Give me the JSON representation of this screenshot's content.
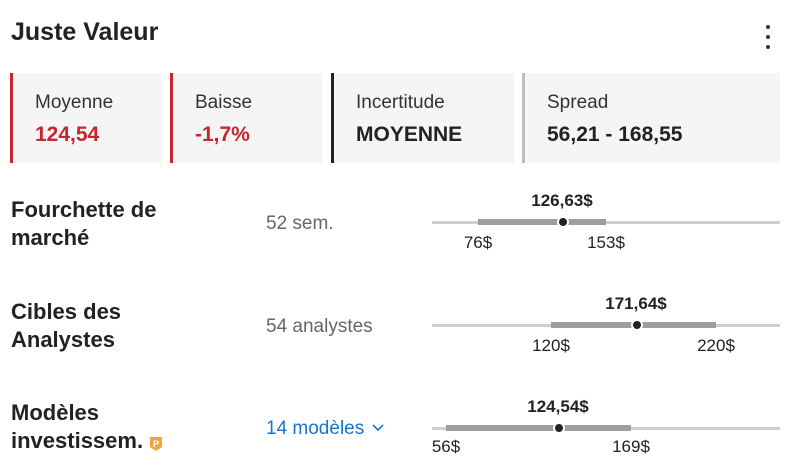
{
  "header": {
    "title": "Juste Valeur",
    "menu_icon": "more-vertical-icon"
  },
  "cards": [
    {
      "label": "Moyenne",
      "value": "124,54",
      "accent": "#c8252c",
      "value_color": "#c8252c"
    },
    {
      "label": "Baisse",
      "value": "-1,7%",
      "accent": "#c8252c",
      "value_color": "#c8252c"
    },
    {
      "label": "Incertitude",
      "value": "MOYENNE",
      "accent": "#222222",
      "value_color": "#222222"
    },
    {
      "label": "Spread",
      "value": "56,21 - 168,55",
      "accent": "#bdbdbd",
      "value_color": "#222222"
    }
  ],
  "rows": [
    {
      "label_line1": "Fourchette de",
      "label_line2": "marché",
      "sub": "52 sem.",
      "current": "126,63$",
      "low": "76$",
      "high": "153$"
    },
    {
      "label_line1": "Cibles des",
      "label_line2": "Analystes",
      "sub": "54 analystes",
      "current": "171,64$",
      "low": "120$",
      "high": "220$"
    },
    {
      "label_line1": "Modèles",
      "label_line2": "investissem.",
      "sub": "14 modèles",
      "sub_icon": "chevron-down-icon",
      "badge_icon": "pro-badge-icon",
      "current": "124,54$",
      "low": "56$",
      "high": "169$"
    }
  ],
  "colors": {
    "negative": "#c8252c",
    "link": "#1a73c9",
    "range_bar": "#9e9e9e",
    "track": "#cfcfcf"
  }
}
